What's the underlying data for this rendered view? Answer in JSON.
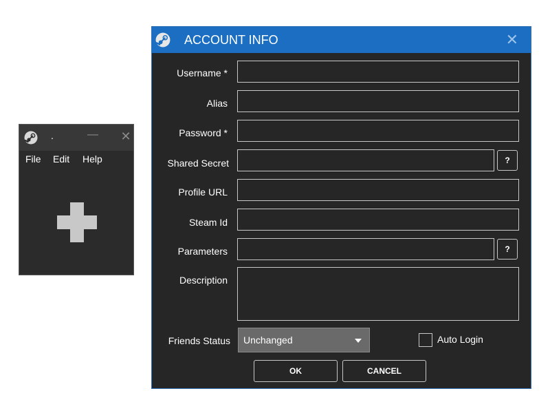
{
  "main_window": {
    "title": ".",
    "minimize_glyph": "—",
    "close_glyph": "✕",
    "menu": [
      {
        "label": "File"
      },
      {
        "label": "Edit"
      },
      {
        "label": "Help"
      }
    ],
    "add_icon": "plus-icon",
    "app_icon": "steam-logo-icon"
  },
  "dialog": {
    "title": "ACCOUNT INFO",
    "close_glyph": "✕",
    "accent_color": "#1b6ec2",
    "fields": {
      "username": {
        "label": "Username *",
        "value": ""
      },
      "alias": {
        "label": "Alias",
        "value": ""
      },
      "password": {
        "label": "Password *",
        "value": ""
      },
      "shared_secret": {
        "label": "Shared Secret",
        "value": ""
      },
      "profile_url": {
        "label": "Profile URL",
        "value": ""
      },
      "steam_id": {
        "label": "Steam Id",
        "value": ""
      },
      "parameters": {
        "label": "Parameters",
        "value": ""
      },
      "description": {
        "label": "Description",
        "value": ""
      }
    },
    "help_label": "?",
    "friends_status": {
      "label": "Friends Status",
      "selected": "Unchanged"
    },
    "auto_login": {
      "label": "Auto Login",
      "checked": false
    },
    "buttons": {
      "ok": "OK",
      "cancel": "CANCEL"
    }
  }
}
